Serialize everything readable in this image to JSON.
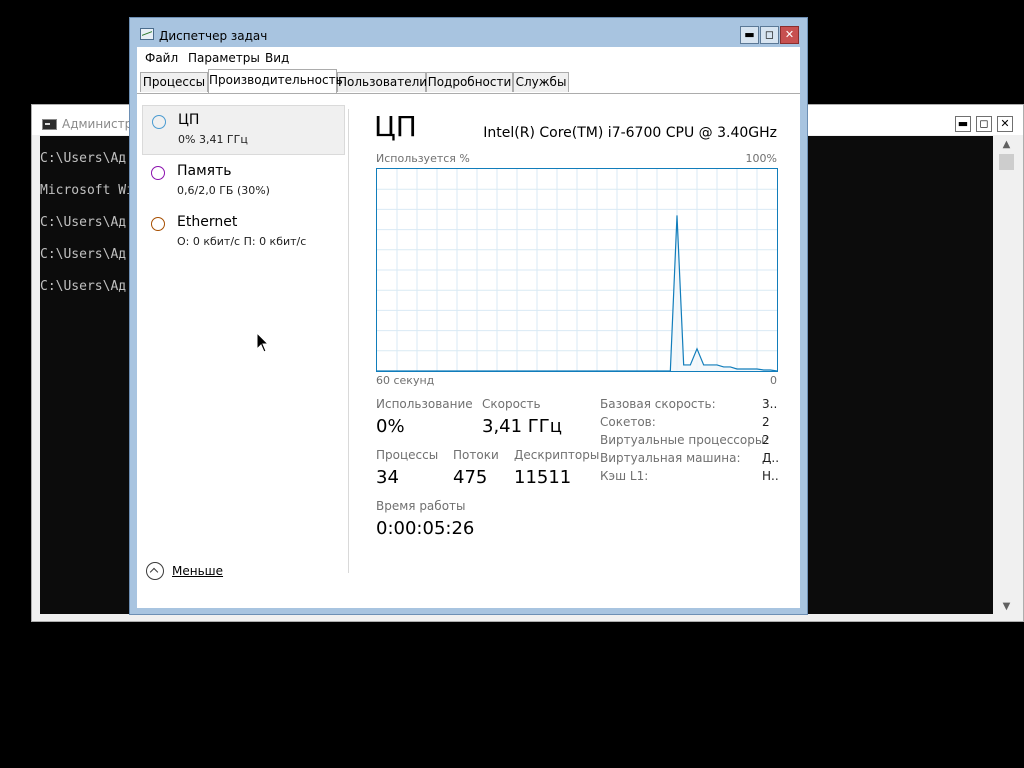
{
  "console": {
    "title": "Администра",
    "lines": [
      "C:\\Users\\Ад",
      "Microsoft Wi",
      "C:\\Users\\Ад",
      "C:\\Users\\Ад",
      "C:\\Users\\Ад"
    ],
    "buttons": {
      "minimize": "▬",
      "maximize": "◻",
      "close": "✕"
    }
  },
  "taskmanager": {
    "title": "Диспетчер задач",
    "buttons": {
      "minimize": "▬",
      "maximize": "◻",
      "close": "✕"
    },
    "menu": [
      "Файл",
      "Параметры",
      "Вид"
    ],
    "tabs": [
      "Процессы",
      "Производительность",
      "Пользователи",
      "Подробности",
      "Службы"
    ],
    "active_tab": "Производительность",
    "resources": [
      {
        "name": "ЦП",
        "detail": "0% 3,41 ГГц",
        "color": "#4a9bd1"
      },
      {
        "name": "Память",
        "detail": "0,6/2,0 ГБ (30%)",
        "color": "#8b12ae"
      },
      {
        "name": "Ethernet",
        "detail": "О: 0 кбит/с  П: 0 кбит/с",
        "color": "#a74f01"
      }
    ],
    "cpu": {
      "title": "ЦП",
      "model": "Intel(R) Core(TM) i7-6700 CPU @ 3.40GHz",
      "graph_label": "Используется %",
      "graph_max": "100%",
      "graph_time": "60 секунд",
      "graph_min": "0",
      "stats": {
        "usage_label": "Использование",
        "usage": "0%",
        "speed_label": "Скорость",
        "speed": "3,41 ГГц",
        "processes_label": "Процессы",
        "processes": "34",
        "threads_label": "Потоки",
        "threads": "475",
        "handles_label": "Дескрипторы",
        "handles": "11511",
        "uptime_label": "Время работы",
        "uptime": "0:00:05:26"
      },
      "info": [
        {
          "key": "Базовая скорость:",
          "value": "3.."
        },
        {
          "key": "Сокетов:",
          "value": "2"
        },
        {
          "key": "Виртуальные процессоры:",
          "value": "2"
        },
        {
          "key": "Виртуальная машина:",
          "value": "Д.."
        },
        {
          "key": "Кэш L1:",
          "value": "Н.."
        }
      ]
    },
    "fewer_details": "Меньше"
  },
  "chart_data": {
    "type": "line",
    "title": "",
    "xlabel": "60 секунд",
    "ylabel": "Используется %",
    "xlim": [
      60,
      0
    ],
    "ylim": [
      0,
      100
    ],
    "color": "#117dbb",
    "fill": "#f1f6fa",
    "grid": true,
    "x": [
      60,
      59,
      58,
      57,
      56,
      55,
      54,
      53,
      52,
      51,
      50,
      49,
      48,
      47,
      46,
      45,
      44,
      43,
      42,
      41,
      40,
      39,
      38,
      37,
      36,
      35,
      34,
      33,
      32,
      31,
      30,
      29,
      28,
      27,
      26,
      25,
      24,
      23,
      22,
      21,
      20,
      19,
      18,
      17,
      16,
      15,
      14,
      13,
      12,
      11,
      10,
      9,
      8,
      7,
      6,
      5,
      4,
      3,
      2,
      1,
      0
    ],
    "values": [
      0,
      0,
      0,
      0,
      0,
      0,
      0,
      0,
      0,
      0,
      0,
      0,
      0,
      0,
      0,
      0,
      0,
      0,
      0,
      0,
      0,
      0,
      0,
      0,
      0,
      0,
      0,
      0,
      0,
      0,
      0,
      0,
      0,
      0,
      0,
      0,
      0,
      0,
      0,
      0,
      0,
      0,
      0,
      0,
      0,
      77,
      3,
      3,
      11,
      3,
      3,
      3,
      2,
      2,
      1,
      1,
      1,
      1,
      0.5,
      0.5,
      0
    ]
  }
}
